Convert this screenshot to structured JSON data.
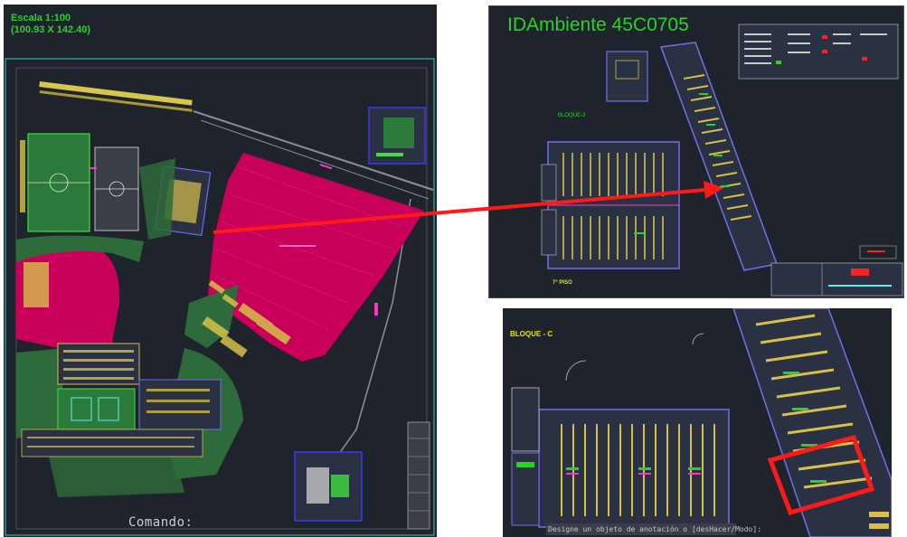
{
  "site_plan": {
    "scale_title": "Escala 1:100",
    "scale_dims": "(100.93 X 142.40)",
    "command_prompt": "Comando:"
  },
  "detail_view": {
    "ambient_id": "IDAmbiente 45C0705",
    "block_label": "BLOQUE-3",
    "floor_label": "7° PISO"
  },
  "zoom_view": {
    "block_label": "BLOQUE - C",
    "status_text": "Designe un objeto de anotación o [desHacer/Modo]:"
  },
  "colors": {
    "cad_background": "#1f242c",
    "highlight_area": "#c8005a",
    "green_area": "#2e6b3a",
    "arrow": "#ff1a1a",
    "selection_box": "#ff1a1a",
    "text_green": "#27d327"
  },
  "icons": [
    "arrow-connector-icon",
    "selection-highlight-icon"
  ]
}
